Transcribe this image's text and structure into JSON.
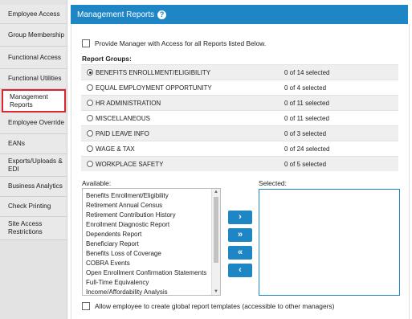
{
  "sidebar": {
    "items": [
      {
        "label": "Employee Access",
        "active": false
      },
      {
        "label": "Group Membership",
        "active": false
      },
      {
        "label": "Functional Access",
        "active": false
      },
      {
        "label": "Functional Utilities",
        "active": false
      },
      {
        "label": "Management Reports",
        "active": true
      },
      {
        "label": "Employee Override",
        "active": false
      },
      {
        "label": "EANs",
        "active": false
      },
      {
        "label": "Exports/Uploads & EDI",
        "active": false
      },
      {
        "label": "Business Analytics",
        "active": false
      },
      {
        "label": "Check Printing",
        "active": false
      },
      {
        "label": "Site Access Restrictions",
        "active": false
      }
    ]
  },
  "header": {
    "title": "Management Reports",
    "help_icon": "?"
  },
  "main": {
    "provide_access_label": "Provide Manager with Access for all Reports listed Below.",
    "report_groups_label": "Report Groups:",
    "groups": [
      {
        "name": "BENEFITS ENROLLMENT/ELIGIBILITY",
        "count": "0 of 14 selected",
        "selected": true
      },
      {
        "name": "EQUAL EMPLOYMENT OPPORTUNITY",
        "count": "0 of 4 selected",
        "selected": false
      },
      {
        "name": "HR ADMINISTRATION",
        "count": "0 of 11 selected",
        "selected": false
      },
      {
        "name": "MISCELLANEOUS",
        "count": "0 of 11 selected",
        "selected": false
      },
      {
        "name": "PAID LEAVE INFO",
        "count": "0 of 3 selected",
        "selected": false
      },
      {
        "name": "WAGE & TAX",
        "count": "0 of 24 selected",
        "selected": false
      },
      {
        "name": "WORKPLACE SAFETY",
        "count": "0 of 5 selected",
        "selected": false
      }
    ],
    "available_label": "Available:",
    "selected_label": "Selected:",
    "available_items": [
      "Benefits Enrollment/Eligibility",
      "Retirement Annual Census",
      "Retirement Contribution History",
      "Enrollment Diagnostic Report",
      "Dependents Report",
      "Beneficiary Report",
      "Benefits Loss of Coverage",
      "COBRA Events",
      "Open Enrollment Confirmation Statements",
      "Full-Time Equivalency",
      "Income/Affordability Analysis"
    ],
    "buttons": {
      "move_right": "›",
      "move_all_right": "»",
      "move_all_left": "«",
      "move_left": "‹"
    },
    "global_templates_label": "Allow employee to create global report templates (accessible to other managers)"
  },
  "colors": {
    "accent": "#1f86c6",
    "active_border": "#d9262f",
    "sidebar_bg": "#e3e3e3"
  }
}
